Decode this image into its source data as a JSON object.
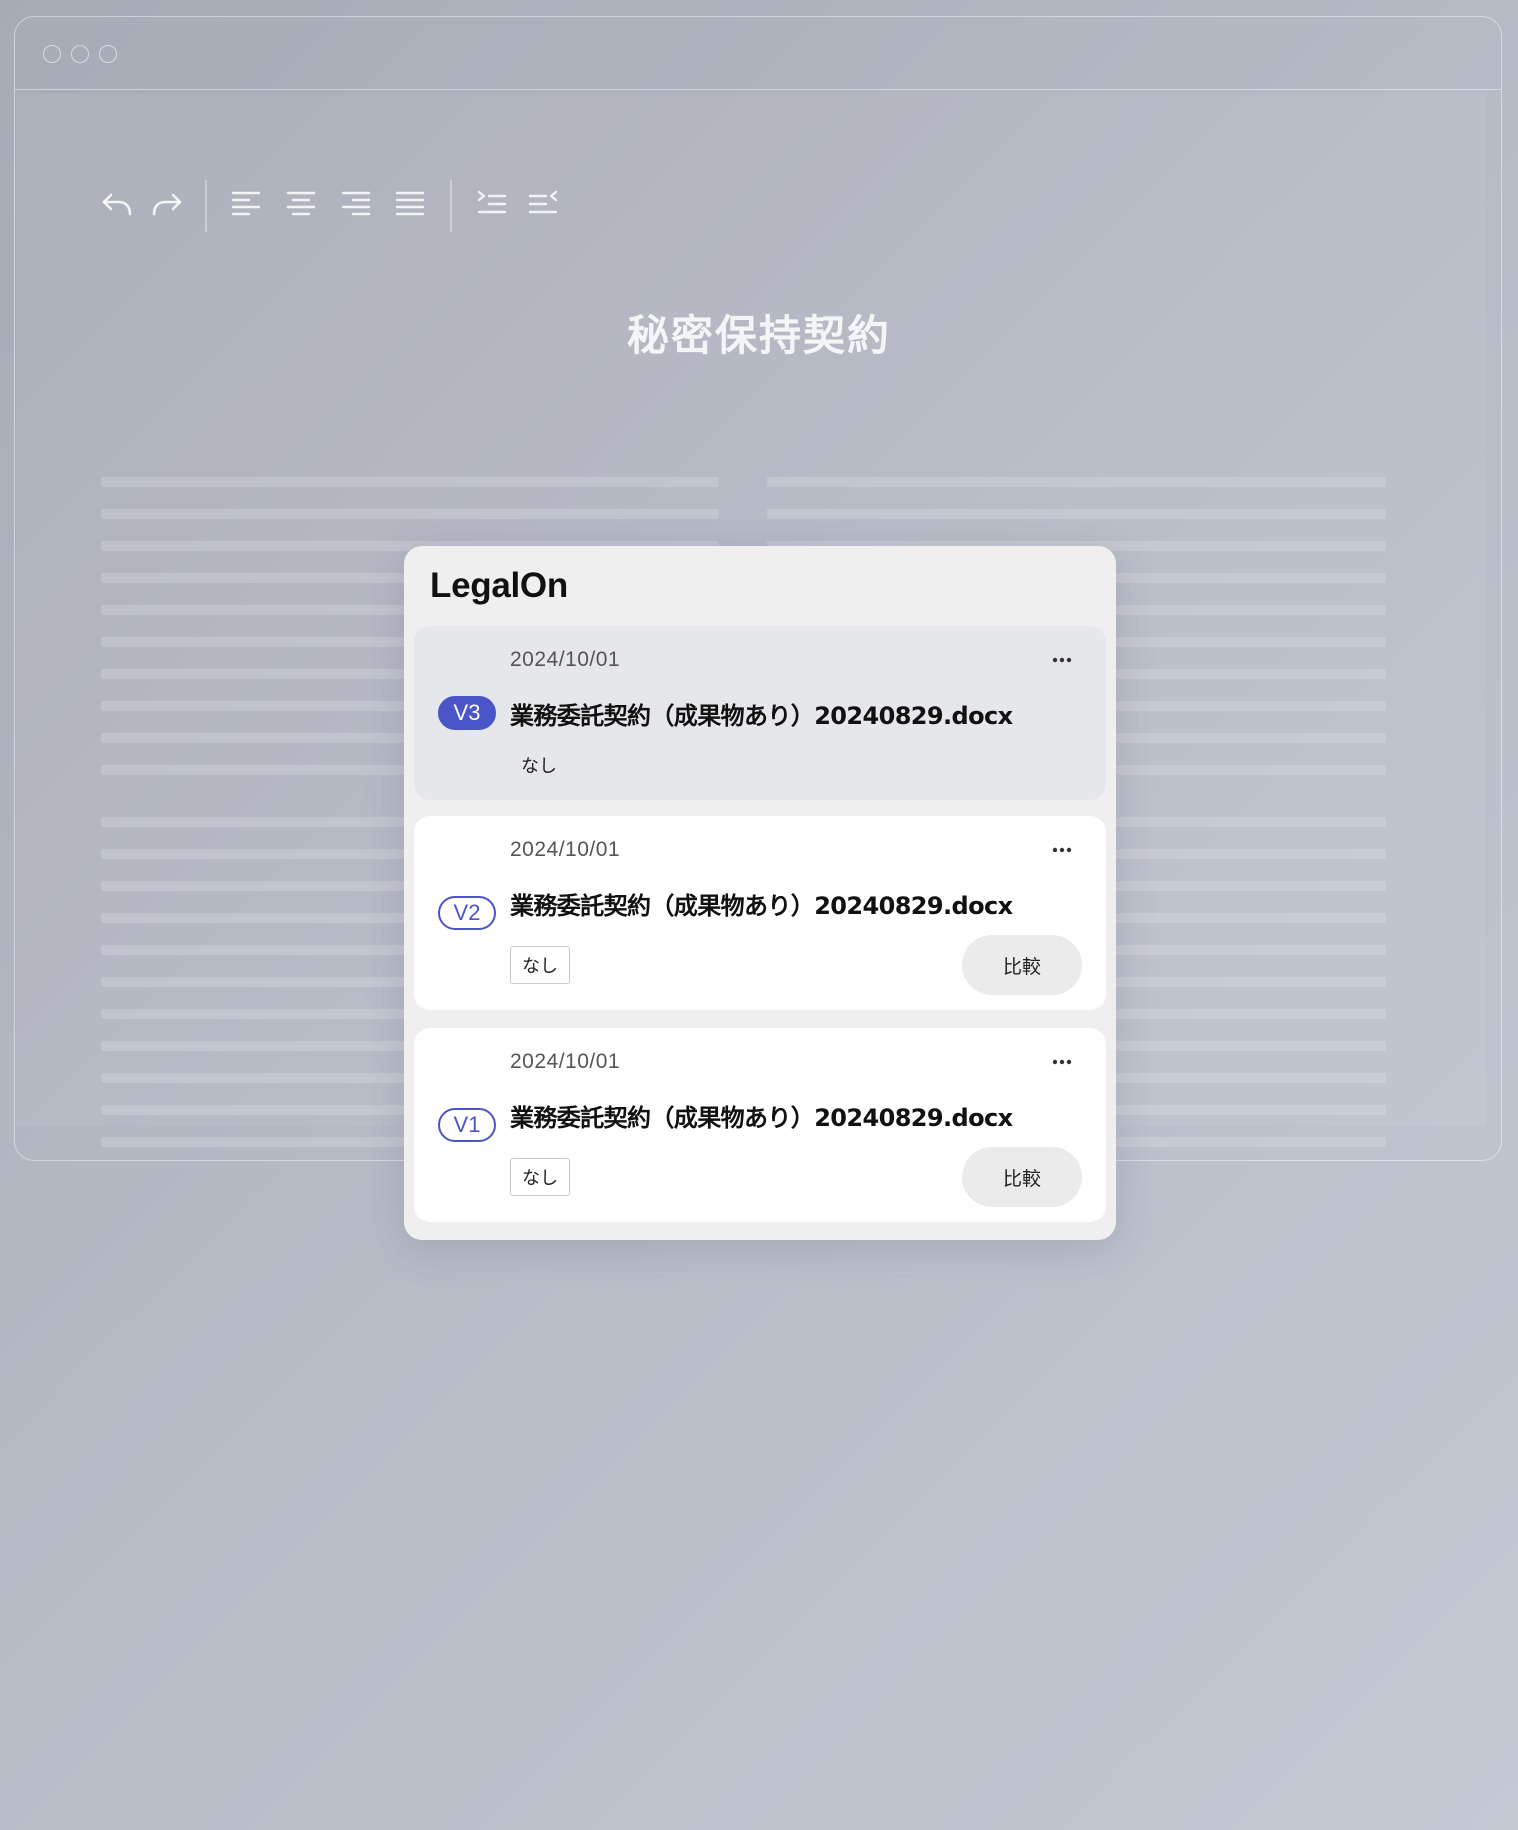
{
  "document": {
    "title": "秘密保持契約"
  },
  "toolbar": {
    "icons": [
      "undo-icon",
      "redo-icon",
      "align-left-icon",
      "align-center-icon",
      "align-right-icon",
      "align-justify-icon",
      "indent-increase-icon",
      "indent-decrease-icon"
    ]
  },
  "panel": {
    "title": "LegalOn",
    "versions": [
      {
        "date": "2024/10/01",
        "version": "V3",
        "filename": "業務委託契約（成果物あり）20240829.docx",
        "tag": "なし",
        "active": true
      },
      {
        "date": "2024/10/01",
        "version": "V2",
        "filename": "業務委託契約（成果物あり）20240829.docx",
        "tag": "なし",
        "compare_label": "比較"
      },
      {
        "date": "2024/10/01",
        "version": "V1",
        "filename": "業務委託契約（成果物あり）20240829.docx",
        "tag": "なし",
        "compare_label": "比較"
      }
    ]
  },
  "colors": {
    "accent": "#4a55c7",
    "panel_bg": "#efeff0",
    "active_card_bg": "#e6e7ea"
  }
}
